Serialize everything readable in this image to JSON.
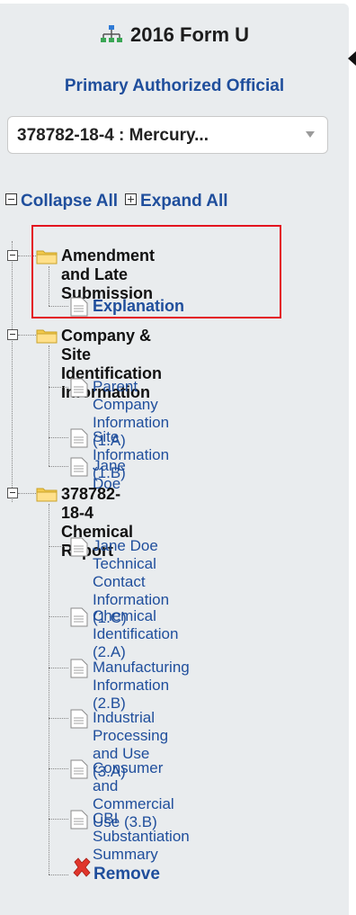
{
  "header": {
    "title": "2016 Form U",
    "subtitle": "Primary Authorized Official"
  },
  "selector": {
    "value": "378782-18-4 : Mercury..."
  },
  "tree_controls": {
    "collapse_all": "Collapse All",
    "expand_all": "Expand All"
  },
  "tree": {
    "amendment": {
      "label_line1": "Amendment and Late",
      "label_line2": "Submission",
      "children": {
        "explanation": "Explanation"
      }
    },
    "company": {
      "label_line1": "Company & Site",
      "label_line2": "Identification Information",
      "children": {
        "parent_company_1": "Parent Company",
        "parent_company_2": "Information (1.A)",
        "site_info": "Site Information (1.B)",
        "jane_doe": "Jane Doe"
      }
    },
    "chemical": {
      "label_line1": "378782-18-4",
      "label_line2": "Chemical Report",
      "children": {
        "tech_contact_1": "Jane Doe",
        "tech_contact_2": "Technical Contact",
        "tech_contact_3": "Information (1.C)",
        "chem_id_1": "Chemical Identification",
        "chem_id_2": "(2.A)",
        "manuf_1": "Manufacturing",
        "manuf_2": "Information (2.B)",
        "industrial_1": "Industrial Processing",
        "industrial_2": "and Use (3.A)",
        "consumer_1": "Consumer and",
        "consumer_2": "Commercial Use (3.B)",
        "cbi_1": "CBI Substantiation",
        "cbi_2": "Summary"
      }
    },
    "remove": "Remove"
  },
  "colors": {
    "panel": "#e9ecee",
    "link": "#1f4e9c",
    "highlight": "#e3131f",
    "folder": "#f2c94c"
  }
}
